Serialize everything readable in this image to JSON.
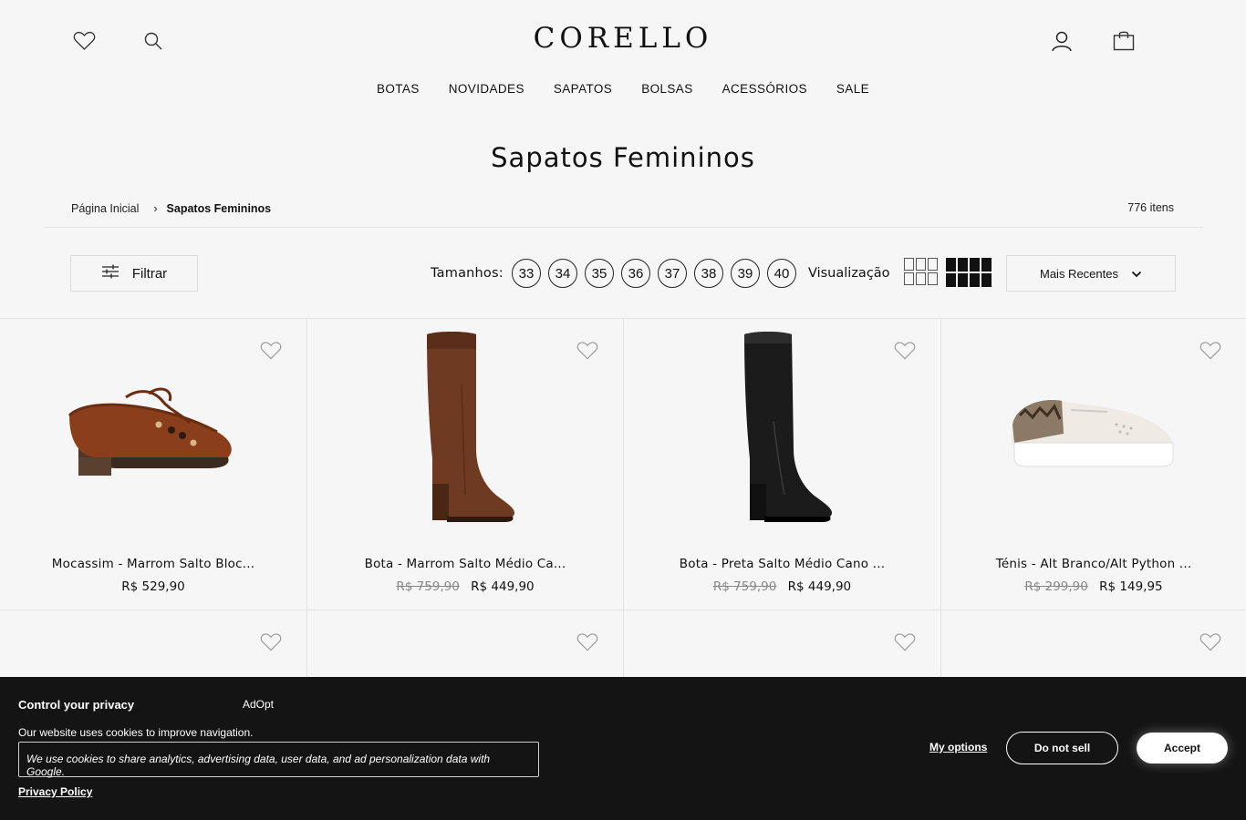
{
  "header": {
    "logo": "CORELLO",
    "icons": [
      "heart-icon",
      "search-icon",
      "user-icon",
      "bag-icon"
    ]
  },
  "nav": {
    "items": [
      "BOTAS",
      "NOVIDADES",
      "SAPATOS",
      "BOLSAS",
      "ACESSÓRIOS",
      "SALE"
    ]
  },
  "page": {
    "title": "Sapatos Femininos",
    "item_count": "776 itens"
  },
  "breadcrumb": {
    "home": "Página Inicial",
    "separator": "›",
    "current": "Sapatos Femininos"
  },
  "toolbar": {
    "filter_label": "Filtrar",
    "sizes_label": "Tamanhos:",
    "sizes": [
      "33",
      "34",
      "35",
      "36",
      "37",
      "38",
      "39",
      "40"
    ],
    "view_label": "Visualização",
    "sort_value": "Mais Recentes"
  },
  "products": [
    {
      "name": "Mocassim - Marrom Salto Bloc...",
      "old_price": "",
      "price": "R$ 529,90",
      "image": "brown-loafer"
    },
    {
      "name": "Bota - Marrom Salto Médio Ca...",
      "old_price": "R$ 759,90",
      "price": "R$ 449,90",
      "image": "brown-knee-boot"
    },
    {
      "name": "Bota - Preta Salto Médio Cano ...",
      "old_price": "R$ 759,90",
      "price": "R$ 449,90",
      "image": "black-knee-boot"
    },
    {
      "name": "Ténis - Alt Branco/Alt Python ...",
      "old_price": "R$ 299,90",
      "price": "R$ 149,95",
      "image": "white-python-sneaker"
    }
  ],
  "cookie": {
    "title": "Control your privacy",
    "brand": "AdOpt",
    "text": "Our website uses cookies to improve navigation.",
    "box_text": "We use cookies to share analytics, advertising data, user data, and ad personalization data with Google.",
    "policy": "Privacy Policy",
    "options": "My options",
    "do_not_sell": "Do not sell",
    "accept": "Accept"
  },
  "colors": {
    "background": "#f6f6f6",
    "text": "#111111",
    "banner": "#141414"
  }
}
